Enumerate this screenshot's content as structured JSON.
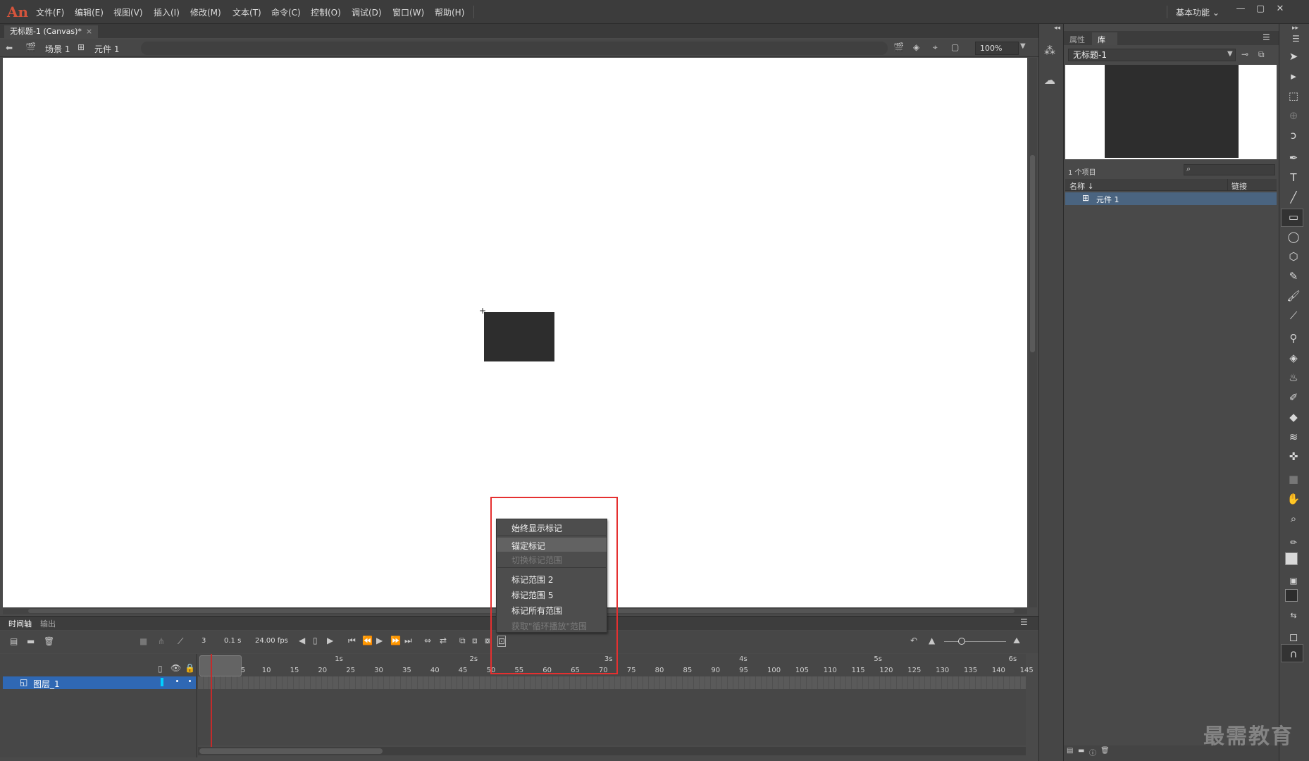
{
  "app": {
    "logo": "An",
    "workspace": "基本功能 ⌄"
  },
  "menu": [
    "文件(F)",
    "编辑(E)",
    "视图(V)",
    "插入(I)",
    "修改(M)",
    "文本(T)",
    "命令(C)",
    "控制(O)",
    "调试(D)",
    "窗口(W)",
    "帮助(H)"
  ],
  "window_controls": {
    "minimize": "—",
    "maximize": "▢",
    "close": "✕"
  },
  "document": {
    "tab_title": "无标题-1 (Canvas)*",
    "tab_close": "×"
  },
  "editbar": {
    "scene": "场景 1",
    "symbol": "元件 1",
    "zoom": "100%"
  },
  "timeline": {
    "tabs": [
      "时间轴",
      "输出"
    ],
    "current_frame": "3",
    "elapsed": "0.1 s",
    "fps": "24.00 fps",
    "layer_name": "图层_1",
    "seconds": [
      "1s",
      "2s",
      "3s",
      "4s",
      "5s",
      "6s"
    ],
    "frame_ticks": [
      "5",
      "10",
      "15",
      "20",
      "25",
      "30",
      "35",
      "40",
      "45",
      "50",
      "55",
      "60",
      "65",
      "70",
      "75",
      "80",
      "85",
      "90",
      "95",
      "100",
      "105",
      "110",
      "115",
      "120",
      "125",
      "130",
      "135",
      "140",
      "145"
    ]
  },
  "context_menu": {
    "items": [
      {
        "label": "始终显示标记",
        "enabled": true
      },
      {
        "label": "锚定标记",
        "enabled": true,
        "hovered": true
      },
      {
        "label": "切换标记范围",
        "enabled": false
      },
      {
        "label": "标记范围 2",
        "enabled": true
      },
      {
        "label": "标记范围 5",
        "enabled": true
      },
      {
        "label": "标记所有范围",
        "enabled": true
      },
      {
        "label": "获取\"循环播放\"范围",
        "enabled": false
      }
    ]
  },
  "library": {
    "tabs": [
      "属性",
      "库"
    ],
    "active_tab": "库",
    "document_select": "无标题-1",
    "item_count": "1 个项目",
    "columns": {
      "name": "名称 ↓",
      "linkage": "链接"
    },
    "items": [
      {
        "name": "元件 1"
      }
    ]
  },
  "watermark": "最需教育",
  "colors": {
    "accent": "#2f68b4",
    "highlight": "#e53030",
    "playhead": "#c42b2b"
  }
}
